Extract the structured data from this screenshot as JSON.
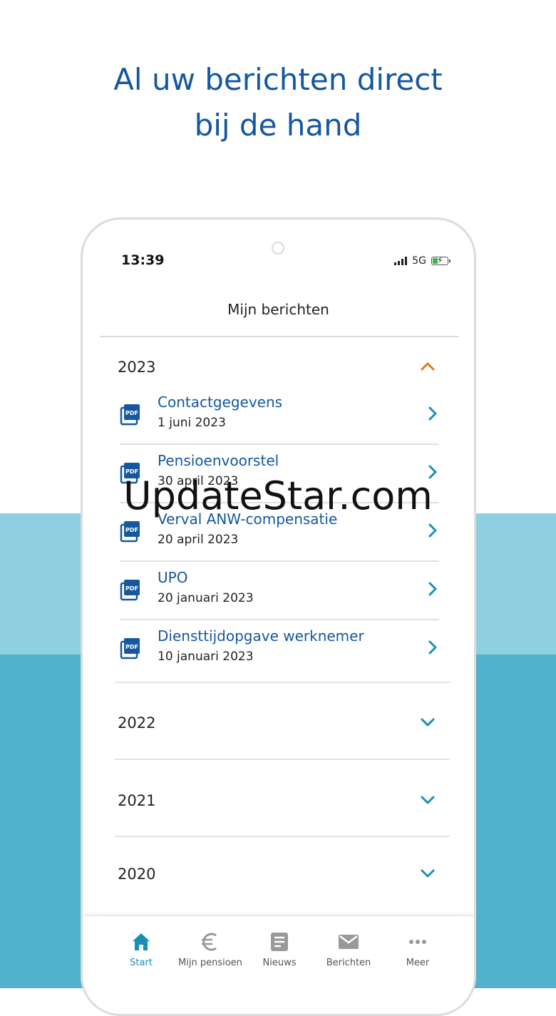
{
  "headline": {
    "line1": "Al uw berichten direct",
    "line2": "bij de hand"
  },
  "status_bar": {
    "time": "13:39",
    "network": "5G",
    "battery_level": 0.35
  },
  "screen": {
    "title": "Mijn berichten",
    "years": [
      {
        "year": "2023",
        "expanded": true
      },
      {
        "year": "2022",
        "expanded": false
      },
      {
        "year": "2021",
        "expanded": false
      },
      {
        "year": "2020",
        "expanded": false
      }
    ],
    "messages_2023": [
      {
        "title": "Contactgegevens",
        "date": "1 juni 2023",
        "icon": "pdf-icon"
      },
      {
        "title": "Pensioenvoorstel",
        "date": "30 april 2023",
        "icon": "pdf-icon"
      },
      {
        "title": "Verval ANW-compensatie",
        "date": "20 april 2023",
        "icon": "pdf-icon"
      },
      {
        "title": "UPO",
        "date": "20 januari 2023",
        "icon": "pdf-icon"
      },
      {
        "title": "Diensttijdopgave werknemer",
        "date": "10 januari 2023",
        "icon": "pdf-icon"
      }
    ]
  },
  "bottom_nav": {
    "active": "Start",
    "items": [
      {
        "label": "Start",
        "icon": "home-icon"
      },
      {
        "label": "Mijn pensioen",
        "icon": "euro-icon"
      },
      {
        "label": "Nieuws",
        "icon": "news-icon"
      },
      {
        "label": "Berichten",
        "icon": "mail-icon"
      },
      {
        "label": "Meer",
        "icon": "more-icon"
      }
    ]
  },
  "colors": {
    "brand_blue": "#1558a0",
    "accent_orange": "#e07b1a",
    "chevron_teal": "#1a8fb5",
    "band_light": "#8ecfe0",
    "band_dark": "#52b1cb"
  },
  "watermark": "UpdateStar.com"
}
